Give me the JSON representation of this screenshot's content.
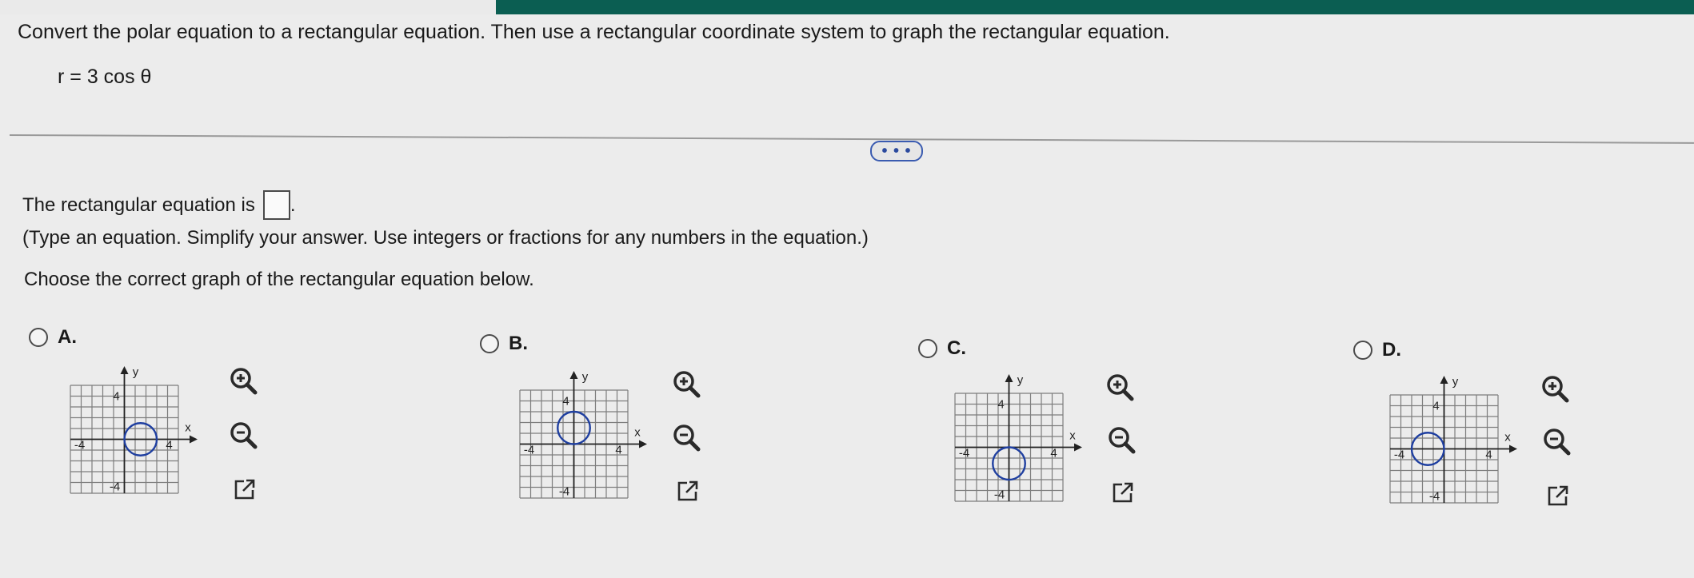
{
  "question": {
    "prompt": "Convert the polar equation to a rectangular equation. Then use a rectangular coordinate system to graph the rectangular equation.",
    "equation": "r = 3 cos θ",
    "more_button": "• • •",
    "answer_intro": "The rectangular equation is",
    "answer_value": "",
    "answer_period": ".",
    "instructions": "(Type an equation. Simplify your answer. Use integers or fractions for any numbers in the equation.)",
    "choose_prompt": "Choose the correct graph of the rectangular equation below."
  },
  "options": [
    {
      "label": "A.",
      "tick_pos": "4",
      "tick_neg": "-4",
      "x_label": "x",
      "y_label": "y",
      "circle_center": [
        1.5,
        0
      ],
      "circle_radius": 1.5
    },
    {
      "label": "B.",
      "tick_pos": "4",
      "tick_neg": "-4",
      "x_label": "x",
      "y_label": "y",
      "circle_center": [
        0,
        1.5
      ],
      "circle_radius": 1.5
    },
    {
      "label": "C.",
      "tick_pos": "4",
      "tick_neg": "-4",
      "x_label": "x",
      "y_label": "y",
      "circle_center": [
        0,
        -1.5
      ],
      "circle_radius": 1.5
    },
    {
      "label": "D.",
      "tick_pos": "4",
      "tick_neg": "-4",
      "x_label": "x",
      "y_label": "y",
      "circle_center": [
        -1.5,
        0
      ],
      "circle_radius": 1.5
    }
  ],
  "icons": {
    "zoom_in": "zoom-in-icon",
    "zoom_out": "zoom-out-icon",
    "popout": "popout-icon"
  },
  "colors": {
    "circle": "#1f3fa0",
    "grid": "#7d7d7d",
    "accent": "#0b5e52"
  }
}
